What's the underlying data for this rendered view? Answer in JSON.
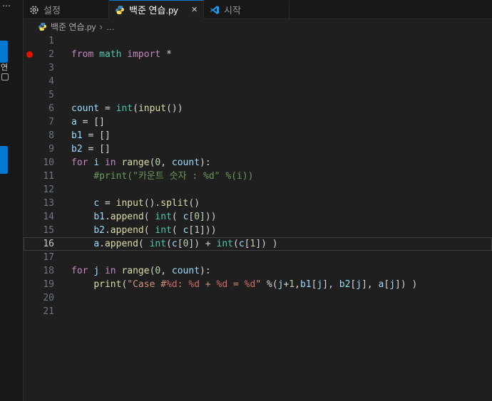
{
  "window": {
    "overflow_dots": "⋯"
  },
  "left_strip": {
    "partial_label": "연"
  },
  "tabs": [
    {
      "label": "설정",
      "icon": "settings-gear-icon",
      "active": false
    },
    {
      "label": "백준 연습.py",
      "icon": "python-file-icon",
      "active": true,
      "close_label": "×"
    },
    {
      "label": "시작",
      "icon": "vscode-logo-icon",
      "active": false
    }
  ],
  "breadcrumb": {
    "file": "백준 연습.py",
    "separator": "›",
    "ellipsis": "…"
  },
  "colors": {
    "accent_blue": "#0078d4",
    "breakpoint_red": "#e51400",
    "editor_background": "#1f1f1f",
    "tabbar_background": "#181818",
    "syntax": {
      "keyword": "#C586C0",
      "function": "#DCDCAA",
      "variable": "#9CDCFE",
      "number": "#B5CEA8",
      "string": "#CE9178",
      "comment": "#6A9955",
      "class": "#4EC9B0",
      "operator": "#D4D4D4",
      "format_placeholder": "#D16969"
    }
  },
  "editor": {
    "language": "python",
    "lines": [
      {
        "n": 1,
        "tokens": []
      },
      {
        "n": 2,
        "breakpoint": true,
        "tokens": [
          [
            "kw",
            "from"
          ],
          [
            "pl",
            " "
          ],
          [
            "cls",
            "math"
          ],
          [
            "pl",
            " "
          ],
          [
            "kw",
            "import"
          ],
          [
            "pl",
            " "
          ],
          [
            "op",
            "*"
          ]
        ]
      },
      {
        "n": 3,
        "tokens": []
      },
      {
        "n": 4,
        "tokens": []
      },
      {
        "n": 5,
        "tokens": []
      },
      {
        "n": 6,
        "tokens": [
          [
            "var",
            "count"
          ],
          [
            "pl",
            " "
          ],
          [
            "op",
            "="
          ],
          [
            "pl",
            " "
          ],
          [
            "cls",
            "int"
          ],
          [
            "pl",
            "("
          ],
          [
            "fn",
            "input"
          ],
          [
            "pl",
            "())"
          ]
        ]
      },
      {
        "n": 7,
        "tokens": [
          [
            "var",
            "a"
          ],
          [
            "pl",
            " "
          ],
          [
            "op",
            "="
          ],
          [
            "pl",
            " []"
          ]
        ]
      },
      {
        "n": 8,
        "tokens": [
          [
            "var",
            "b1"
          ],
          [
            "pl",
            " "
          ],
          [
            "op",
            "="
          ],
          [
            "pl",
            " []"
          ]
        ]
      },
      {
        "n": 9,
        "tokens": [
          [
            "var",
            "b2"
          ],
          [
            "pl",
            " "
          ],
          [
            "op",
            "="
          ],
          [
            "pl",
            " []"
          ]
        ]
      },
      {
        "n": 10,
        "tokens": [
          [
            "kw",
            "for"
          ],
          [
            "pl",
            " "
          ],
          [
            "var",
            "i"
          ],
          [
            "pl",
            " "
          ],
          [
            "kw",
            "in"
          ],
          [
            "pl",
            " "
          ],
          [
            "fn",
            "range"
          ],
          [
            "pl",
            "("
          ],
          [
            "num",
            "0"
          ],
          [
            "pl",
            ", "
          ],
          [
            "var",
            "count"
          ],
          [
            "pl",
            "):"
          ]
        ]
      },
      {
        "n": 11,
        "tokens": [
          [
            "cmt",
            "    #print(\"카운트 숫자 : %d\" %(i))"
          ]
        ]
      },
      {
        "n": 12,
        "tokens": []
      },
      {
        "n": 13,
        "tokens": [
          [
            "pl",
            "    "
          ],
          [
            "var",
            "c"
          ],
          [
            "pl",
            " "
          ],
          [
            "op",
            "="
          ],
          [
            "pl",
            " "
          ],
          [
            "fn",
            "input"
          ],
          [
            "pl",
            "()."
          ],
          [
            "fn",
            "split"
          ],
          [
            "pl",
            "()"
          ]
        ]
      },
      {
        "n": 14,
        "tokens": [
          [
            "pl",
            "    "
          ],
          [
            "var",
            "b1"
          ],
          [
            "pl",
            "."
          ],
          [
            "fn",
            "append"
          ],
          [
            "pl",
            "( "
          ],
          [
            "cls",
            "int"
          ],
          [
            "pl",
            "( "
          ],
          [
            "var",
            "c"
          ],
          [
            "pl",
            "["
          ],
          [
            "num",
            "0"
          ],
          [
            "pl",
            "]))"
          ]
        ]
      },
      {
        "n": 15,
        "tokens": [
          [
            "pl",
            "    "
          ],
          [
            "var",
            "b2"
          ],
          [
            "pl",
            "."
          ],
          [
            "fn",
            "append"
          ],
          [
            "pl",
            "( "
          ],
          [
            "cls",
            "int"
          ],
          [
            "pl",
            "( "
          ],
          [
            "var",
            "c"
          ],
          [
            "pl",
            "["
          ],
          [
            "num",
            "1"
          ],
          [
            "pl",
            "]))"
          ]
        ]
      },
      {
        "n": 16,
        "current": true,
        "tokens": [
          [
            "pl",
            "    "
          ],
          [
            "var",
            "a"
          ],
          [
            "pl",
            "."
          ],
          [
            "fn",
            "append"
          ],
          [
            "pl",
            "( "
          ],
          [
            "cls",
            "int"
          ],
          [
            "pl",
            "("
          ],
          [
            "var",
            "c"
          ],
          [
            "pl",
            "["
          ],
          [
            "num",
            "0"
          ],
          [
            "pl",
            "]) "
          ],
          [
            "op",
            "+"
          ],
          [
            "pl",
            " "
          ],
          [
            "cls",
            "int"
          ],
          [
            "pl",
            "("
          ],
          [
            "var",
            "c"
          ],
          [
            "pl",
            "["
          ],
          [
            "num",
            "1"
          ],
          [
            "pl",
            "]) )"
          ]
        ]
      },
      {
        "n": 17,
        "tokens": []
      },
      {
        "n": 18,
        "tokens": [
          [
            "kw",
            "for"
          ],
          [
            "pl",
            " "
          ],
          [
            "var",
            "j"
          ],
          [
            "pl",
            " "
          ],
          [
            "kw",
            "in"
          ],
          [
            "pl",
            " "
          ],
          [
            "fn",
            "range"
          ],
          [
            "pl",
            "("
          ],
          [
            "num",
            "0"
          ],
          [
            "pl",
            ", "
          ],
          [
            "var",
            "count"
          ],
          [
            "pl",
            "):"
          ]
        ]
      },
      {
        "n": 19,
        "tokens": [
          [
            "pl",
            "    "
          ],
          [
            "fn",
            "print"
          ],
          [
            "pl",
            "("
          ],
          [
            "str",
            "\"Case #"
          ],
          [
            "fmt",
            "%d"
          ],
          [
            "str",
            ": "
          ],
          [
            "fmt",
            "%d"
          ],
          [
            "str",
            " + "
          ],
          [
            "fmt",
            "%d"
          ],
          [
            "str",
            " = "
          ],
          [
            "fmt",
            "%d"
          ],
          [
            "str",
            "\""
          ],
          [
            "pl",
            " "
          ],
          [
            "op",
            "%"
          ],
          [
            "pl",
            "("
          ],
          [
            "var",
            "j"
          ],
          [
            "op",
            "+"
          ],
          [
            "num",
            "1"
          ],
          [
            "pl",
            ","
          ],
          [
            "var",
            "b1"
          ],
          [
            "pl",
            "["
          ],
          [
            "var",
            "j"
          ],
          [
            "pl",
            "], "
          ],
          [
            "var",
            "b2"
          ],
          [
            "pl",
            "["
          ],
          [
            "var",
            "j"
          ],
          [
            "pl",
            "], "
          ],
          [
            "var",
            "a"
          ],
          [
            "pl",
            "["
          ],
          [
            "var",
            "j"
          ],
          [
            "pl",
            "]) )"
          ]
        ]
      },
      {
        "n": 20,
        "tokens": []
      },
      {
        "n": 21,
        "tokens": []
      }
    ]
  }
}
